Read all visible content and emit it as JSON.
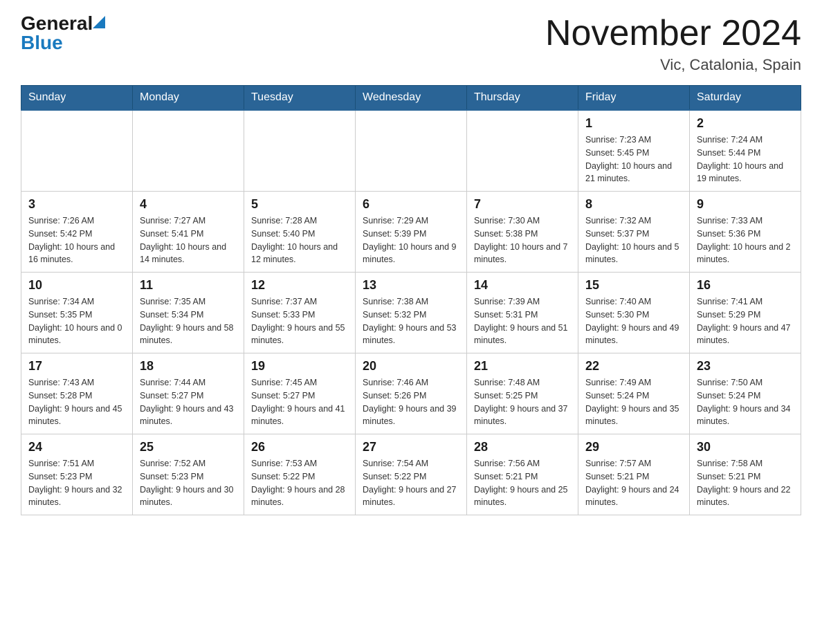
{
  "header": {
    "logo_general": "General",
    "logo_blue": "Blue",
    "month_title": "November 2024",
    "location": "Vic, Catalonia, Spain"
  },
  "weekdays": [
    "Sunday",
    "Monday",
    "Tuesday",
    "Wednesday",
    "Thursday",
    "Friday",
    "Saturday"
  ],
  "weeks": [
    {
      "days": [
        {
          "num": "",
          "info": ""
        },
        {
          "num": "",
          "info": ""
        },
        {
          "num": "",
          "info": ""
        },
        {
          "num": "",
          "info": ""
        },
        {
          "num": "",
          "info": ""
        },
        {
          "num": "1",
          "info": "Sunrise: 7:23 AM\nSunset: 5:45 PM\nDaylight: 10 hours and 21 minutes."
        },
        {
          "num": "2",
          "info": "Sunrise: 7:24 AM\nSunset: 5:44 PM\nDaylight: 10 hours and 19 minutes."
        }
      ]
    },
    {
      "days": [
        {
          "num": "3",
          "info": "Sunrise: 7:26 AM\nSunset: 5:42 PM\nDaylight: 10 hours and 16 minutes."
        },
        {
          "num": "4",
          "info": "Sunrise: 7:27 AM\nSunset: 5:41 PM\nDaylight: 10 hours and 14 minutes."
        },
        {
          "num": "5",
          "info": "Sunrise: 7:28 AM\nSunset: 5:40 PM\nDaylight: 10 hours and 12 minutes."
        },
        {
          "num": "6",
          "info": "Sunrise: 7:29 AM\nSunset: 5:39 PM\nDaylight: 10 hours and 9 minutes."
        },
        {
          "num": "7",
          "info": "Sunrise: 7:30 AM\nSunset: 5:38 PM\nDaylight: 10 hours and 7 minutes."
        },
        {
          "num": "8",
          "info": "Sunrise: 7:32 AM\nSunset: 5:37 PM\nDaylight: 10 hours and 5 minutes."
        },
        {
          "num": "9",
          "info": "Sunrise: 7:33 AM\nSunset: 5:36 PM\nDaylight: 10 hours and 2 minutes."
        }
      ]
    },
    {
      "days": [
        {
          "num": "10",
          "info": "Sunrise: 7:34 AM\nSunset: 5:35 PM\nDaylight: 10 hours and 0 minutes."
        },
        {
          "num": "11",
          "info": "Sunrise: 7:35 AM\nSunset: 5:34 PM\nDaylight: 9 hours and 58 minutes."
        },
        {
          "num": "12",
          "info": "Sunrise: 7:37 AM\nSunset: 5:33 PM\nDaylight: 9 hours and 55 minutes."
        },
        {
          "num": "13",
          "info": "Sunrise: 7:38 AM\nSunset: 5:32 PM\nDaylight: 9 hours and 53 minutes."
        },
        {
          "num": "14",
          "info": "Sunrise: 7:39 AM\nSunset: 5:31 PM\nDaylight: 9 hours and 51 minutes."
        },
        {
          "num": "15",
          "info": "Sunrise: 7:40 AM\nSunset: 5:30 PM\nDaylight: 9 hours and 49 minutes."
        },
        {
          "num": "16",
          "info": "Sunrise: 7:41 AM\nSunset: 5:29 PM\nDaylight: 9 hours and 47 minutes."
        }
      ]
    },
    {
      "days": [
        {
          "num": "17",
          "info": "Sunrise: 7:43 AM\nSunset: 5:28 PM\nDaylight: 9 hours and 45 minutes."
        },
        {
          "num": "18",
          "info": "Sunrise: 7:44 AM\nSunset: 5:27 PM\nDaylight: 9 hours and 43 minutes."
        },
        {
          "num": "19",
          "info": "Sunrise: 7:45 AM\nSunset: 5:27 PM\nDaylight: 9 hours and 41 minutes."
        },
        {
          "num": "20",
          "info": "Sunrise: 7:46 AM\nSunset: 5:26 PM\nDaylight: 9 hours and 39 minutes."
        },
        {
          "num": "21",
          "info": "Sunrise: 7:48 AM\nSunset: 5:25 PM\nDaylight: 9 hours and 37 minutes."
        },
        {
          "num": "22",
          "info": "Sunrise: 7:49 AM\nSunset: 5:24 PM\nDaylight: 9 hours and 35 minutes."
        },
        {
          "num": "23",
          "info": "Sunrise: 7:50 AM\nSunset: 5:24 PM\nDaylight: 9 hours and 34 minutes."
        }
      ]
    },
    {
      "days": [
        {
          "num": "24",
          "info": "Sunrise: 7:51 AM\nSunset: 5:23 PM\nDaylight: 9 hours and 32 minutes."
        },
        {
          "num": "25",
          "info": "Sunrise: 7:52 AM\nSunset: 5:23 PM\nDaylight: 9 hours and 30 minutes."
        },
        {
          "num": "26",
          "info": "Sunrise: 7:53 AM\nSunset: 5:22 PM\nDaylight: 9 hours and 28 minutes."
        },
        {
          "num": "27",
          "info": "Sunrise: 7:54 AM\nSunset: 5:22 PM\nDaylight: 9 hours and 27 minutes."
        },
        {
          "num": "28",
          "info": "Sunrise: 7:56 AM\nSunset: 5:21 PM\nDaylight: 9 hours and 25 minutes."
        },
        {
          "num": "29",
          "info": "Sunrise: 7:57 AM\nSunset: 5:21 PM\nDaylight: 9 hours and 24 minutes."
        },
        {
          "num": "30",
          "info": "Sunrise: 7:58 AM\nSunset: 5:21 PM\nDaylight: 9 hours and 22 minutes."
        }
      ]
    }
  ]
}
